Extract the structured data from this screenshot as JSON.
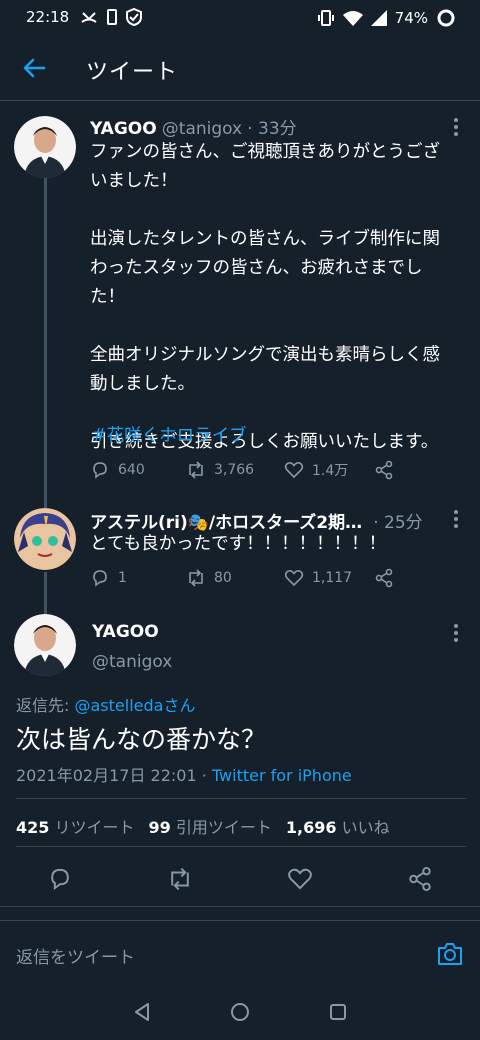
{
  "status": {
    "time": "22:18",
    "battery": "74%"
  },
  "header": {
    "title": "ツイート"
  },
  "tweets": [
    {
      "name": "YAGOO",
      "handle": "@tanigox",
      "time": "· 33分",
      "text": "ファンの皆さん、ご視聴頂きありがとうござ\nいました！\n\n出演したタレントの皆さん、ライブ制作に関\nわったスタッフの皆さん、お疲れさまでし\nた！\n\n全曲オリジナルソングで演出も素晴らしく感\n動しました。\n\n引き続きご支援よろしくお願いいたします。",
      "hashtag": "#花咲くホロライブ",
      "replies": "640",
      "retweets": "3,766",
      "likes": "1.4万"
    },
    {
      "name": "アステル(ri)🎭/ホロスターズ2期…",
      "time": "· 25分",
      "text": "とても良かったです！！！！！！！！",
      "replies": "1",
      "retweets": "80",
      "likes": "1,117"
    }
  ],
  "main_tweet": {
    "name": "YAGOO",
    "handle": "@tanigox",
    "reply_to_label": "返信先: ",
    "reply_to_user": "@astelledaさん",
    "text": "次は皆んなの番かな？",
    "date": "2021年02月17日 22:01 · ",
    "client": "Twitter for iPhone",
    "retweets_count": "425",
    "retweets_label": "リツイート",
    "quotes_count": "99",
    "quotes_label": "引用ツイート",
    "likes_count": "1,696",
    "likes_label": "いいね"
  },
  "reply_bar": {
    "placeholder": "返信をツイート"
  },
  "colors": {
    "background": "#15202b",
    "accent": "#1da1f2",
    "muted": "#8899a6",
    "border": "#38444d"
  }
}
